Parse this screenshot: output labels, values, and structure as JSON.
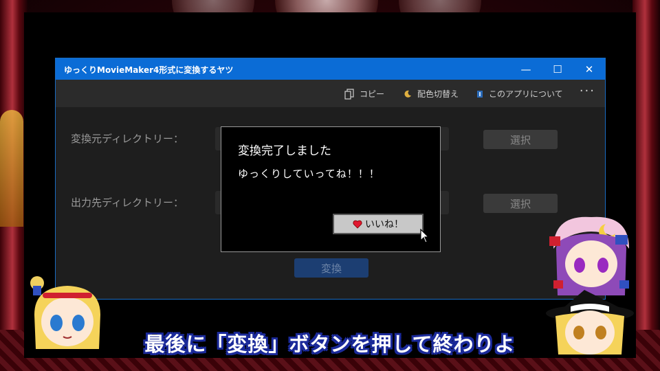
{
  "window": {
    "title": "ゆっくりMovieMaker4形式に変換するヤツ",
    "controls": {
      "minimize": "—",
      "maximize": "☐",
      "close": "✕"
    },
    "accent": "#0b6cd6"
  },
  "toolbar": {
    "copy_label": "コピー",
    "theme_label": "配色切替え",
    "about_label": "このアプリについて",
    "more_label": "···"
  },
  "form": {
    "source_label": "変換元ディレクトリー：",
    "output_label": "出力先ディレクトリー：",
    "select_label": "選択",
    "convert_label": "変換"
  },
  "dialog": {
    "title": "変換完了しました",
    "message": "ゆっくりしていってね！！！",
    "button_label": "いいね！",
    "heart_icon": "heart-icon"
  },
  "subtitle": "最後に「変換」ボタンを押して終わりよ",
  "colors": {
    "subtitle_outline": "#1b2a9a",
    "heart": "#e01830"
  }
}
